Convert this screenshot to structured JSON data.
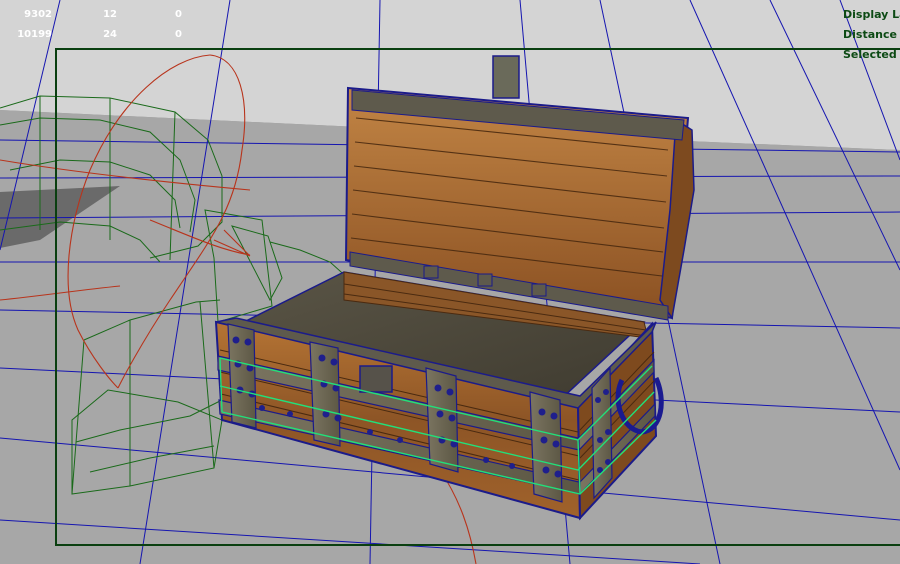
{
  "hud": {
    "poly_stats": [
      {
        "a": "9302",
        "b": "12",
        "c": "0"
      },
      {
        "a": "10199",
        "b": "24",
        "c": "0"
      }
    ],
    "heads_up": [
      "Display Lay",
      "Distance F",
      "Selected C"
    ]
  },
  "colors": {
    "viewport_bg": "#9a9a9a",
    "grid_line": "#1515b0",
    "backdrop": "#d6d6d6",
    "resolution_gate": "#0a3f10",
    "hud_text": "#ffffff",
    "hud_headsup_text": "#0c4a14",
    "wire_green": "#1a6a1a",
    "wire_red": "#b8341c",
    "selection_highlight": "#22e07a",
    "wood": "#a0612a",
    "metal": "#6f6a54"
  }
}
